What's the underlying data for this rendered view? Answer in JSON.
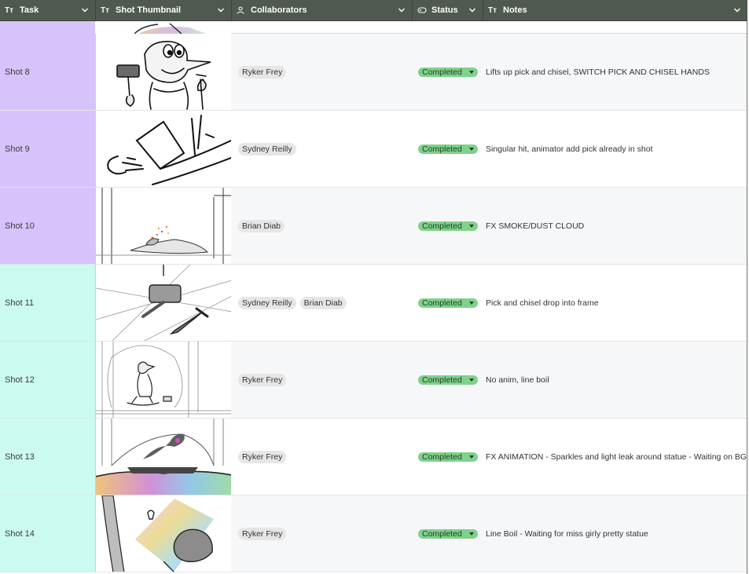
{
  "header": {
    "task": {
      "label": "Task",
      "icon": "text-type-icon",
      "glyph": "Tт"
    },
    "thumbnail": {
      "label": "Shot Thumbnail",
      "icon": "text-type-icon",
      "glyph": "Tт"
    },
    "collaborators": {
      "label": "Collaborators",
      "icon": "person-icon"
    },
    "status": {
      "label": "Status",
      "icon": "status-pill-icon"
    },
    "notes": {
      "label": "Notes",
      "icon": "text-type-icon",
      "glyph": "Tт"
    }
  },
  "colors": {
    "header_bg": "#4f5950",
    "group_purple": "#d7c3fb",
    "group_teal": "#cbfaf1",
    "status_green": "#7fd18b"
  },
  "rows": [
    {
      "task": "Shot 8",
      "collaborators": [
        "Ryker Frey"
      ],
      "status": "Completed",
      "notes": "Lifts up pick and chisel, SWITCH PICK AND CHISEL HANDS",
      "group_color": "#d7c3fb"
    },
    {
      "task": "Shot 9",
      "collaborators": [
        "Sydney Reilly"
      ],
      "status": "Completed",
      "notes": "Singular hit, animator add pick already in shot",
      "group_color": "#d7c3fb"
    },
    {
      "task": "Shot 10",
      "collaborators": [
        "Brian Diab"
      ],
      "status": "Completed",
      "notes": "FX SMOKE/DUST CLOUD",
      "group_color": "#d7c3fb"
    },
    {
      "task": "Shot 11",
      "collaborators": [
        "Sydney Reilly",
        "Brian Diab"
      ],
      "status": "Completed",
      "notes": "Pick and chisel drop into frame",
      "group_color": "#cbfaf1"
    },
    {
      "task": "Shot 12",
      "collaborators": [
        "Ryker Frey"
      ],
      "status": "Completed",
      "notes": "No anim, line boil",
      "group_color": "#cbfaf1"
    },
    {
      "task": "Shot 13",
      "collaborators": [
        "Ryker Frey"
      ],
      "status": "Completed",
      "notes": "FX ANIMATION - Sparkles and light leak around statue - Waiting on BG",
      "group_color": "#cbfaf1"
    },
    {
      "task": "Shot 14",
      "collaborators": [
        "Ryker Frey"
      ],
      "status": "Completed",
      "notes": "Line Boil - Waiting for miss girly pretty statue",
      "group_color": "#cbfaf1"
    }
  ]
}
